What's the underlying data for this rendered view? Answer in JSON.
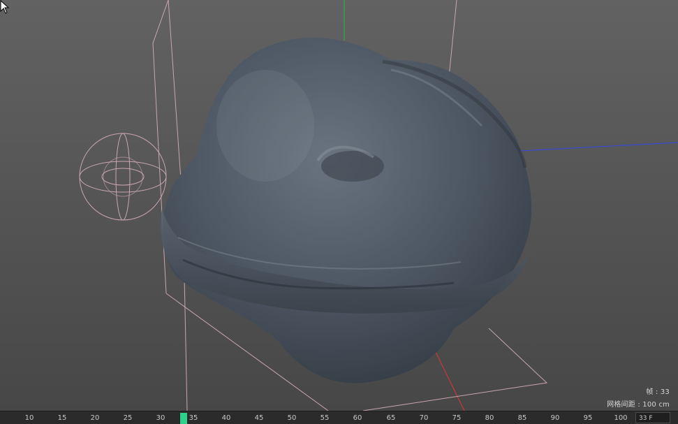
{
  "viewport": {
    "background_top": "#5f5f5f",
    "background_bottom": "#4a4a4a",
    "object_color": "#4f5965",
    "axis_colors": {
      "x": "#c83a3a",
      "y": "#3aa84a",
      "z": "#3a4ad0"
    }
  },
  "hud": {
    "frame_text": "帧 : 33",
    "grid_text": "网格间距 : 100 cm"
  },
  "timeline": {
    "ticks": [
      "10",
      "15",
      "20",
      "25",
      "30",
      "35",
      "40",
      "45",
      "50",
      "55",
      "60",
      "65",
      "70",
      "75",
      "80",
      "85",
      "90",
      "95",
      "100"
    ],
    "current_frame": "33 F",
    "playhead_color": "#2fd08a"
  },
  "icons": {
    "light": "light-gizmo-icon",
    "cursor": "mouse-cursor-icon"
  }
}
